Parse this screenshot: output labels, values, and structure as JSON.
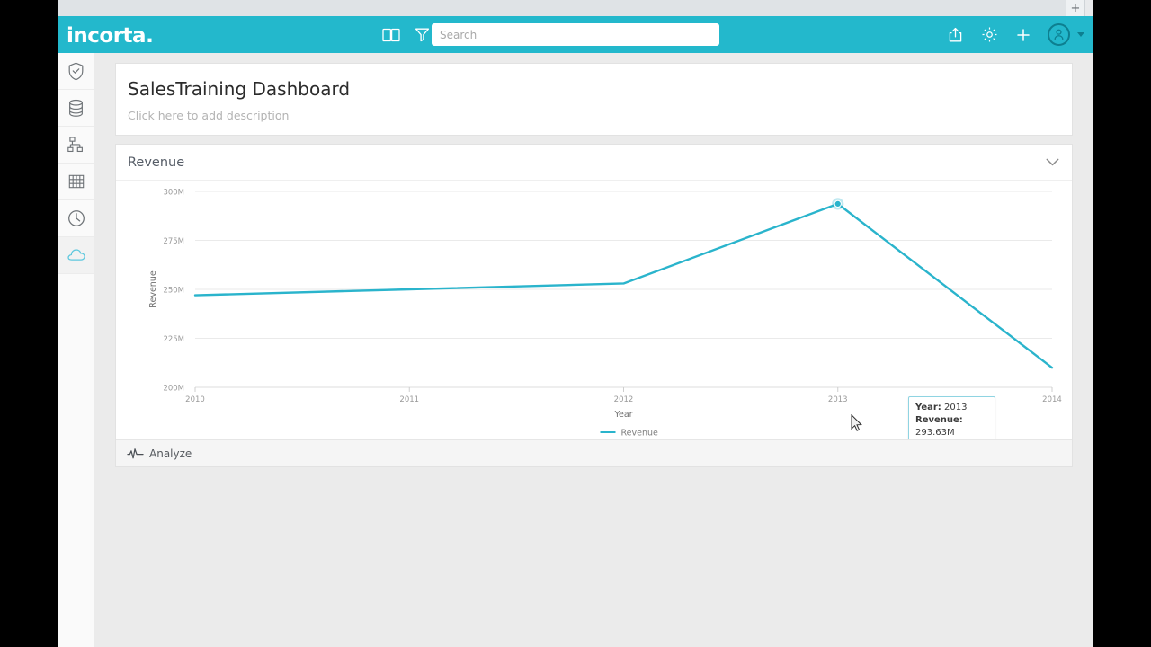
{
  "browser": {
    "new_tab_label": "+"
  },
  "topbar": {
    "logo_text": "incorta",
    "logo_dot": ".",
    "icons": [
      {
        "name": "book-icon",
        "label": "Book"
      },
      {
        "name": "filter-icon",
        "label": "Filter"
      }
    ],
    "search": {
      "placeholder": "Search",
      "value": ""
    },
    "right_icons": [
      {
        "name": "share-icon",
        "label": "Share"
      },
      {
        "name": "gear-icon",
        "label": "Settings"
      },
      {
        "name": "plus-icon",
        "label": "Add"
      },
      {
        "name": "avatar",
        "label": "User"
      },
      {
        "name": "chevron-down-icon",
        "label": "Account menu"
      }
    ]
  },
  "sidebar": {
    "items": [
      {
        "name": "sidebar-item-security",
        "icon": "shield-check-icon",
        "label": "Security",
        "active": false
      },
      {
        "name": "sidebar-item-data",
        "icon": "database-icon",
        "label": "Data",
        "active": false
      },
      {
        "name": "sidebar-item-schema",
        "icon": "schema-icon",
        "label": "Schema",
        "active": false
      },
      {
        "name": "sidebar-item-tables",
        "icon": "grid-icon",
        "label": "Tables",
        "active": false
      },
      {
        "name": "sidebar-item-scheduler",
        "icon": "clock-icon",
        "label": "Scheduler",
        "active": false
      },
      {
        "name": "sidebar-item-cloud",
        "icon": "cloud-icon",
        "label": "Cloud",
        "active": true
      }
    ]
  },
  "dashboard": {
    "title": "SalesTraining Dashboard",
    "description_placeholder": "Click here to add description"
  },
  "card": {
    "title": "Revenue",
    "collapse_icon": "chevron-down-icon",
    "footer": {
      "analyze_label": "Analyze",
      "analyze_icon": "pulse-icon"
    }
  },
  "tooltip": {
    "year_label": "Year:",
    "year_value": "2013",
    "revenue_label": "Revenue:",
    "revenue_value": "293.63M"
  },
  "colors": {
    "brand": "#23b8cc",
    "line": "#2ab4cc",
    "page_bg": "#ebebeb",
    "card_bg": "#ffffff",
    "footer_bg": "#f5f5f5"
  },
  "chart_data": {
    "type": "line",
    "title": "Revenue",
    "xlabel": "Year",
    "ylabel": "Revenue",
    "x": [
      2010,
      2011,
      2012,
      2013,
      2014
    ],
    "categories": [
      "2010",
      "2011",
      "2012",
      "2013",
      "2014"
    ],
    "xtick_labels": [
      "2010",
      "2011",
      "2012",
      "2013",
      "2014"
    ],
    "ytick_labels": [
      "200M",
      "225M",
      "250M",
      "275M",
      "300M"
    ],
    "ytick_values": [
      200000000,
      225000000,
      250000000,
      275000000,
      300000000
    ],
    "ylim": [
      200000000,
      300000000
    ],
    "grid": true,
    "legend": [
      {
        "name": "Revenue",
        "color": "#2ab4cc"
      }
    ],
    "legend_position": "bottom",
    "series": [
      {
        "name": "Revenue",
        "color": "#2ab4cc",
        "values": [
          247000000,
          250000000,
          253000000,
          293630000,
          210000000
        ],
        "value_labels": [
          "247M",
          "250M",
          "253M",
          "293.63M",
          "210M"
        ]
      }
    ],
    "highlighted_point": {
      "x": "2013",
      "y": 293630000,
      "label": "293.63M"
    }
  }
}
